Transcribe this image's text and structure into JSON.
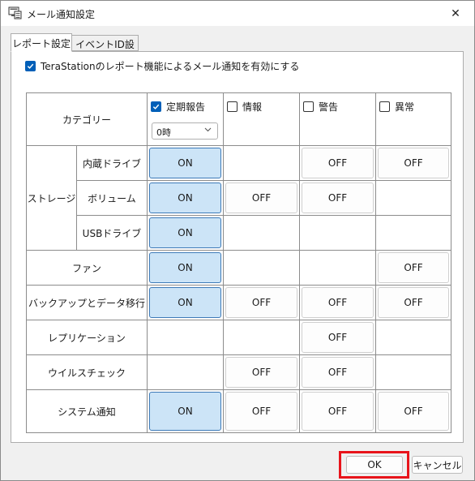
{
  "window": {
    "title": "メール通知設定",
    "icon": "app-window-icon",
    "close_glyph": "✕"
  },
  "tabs": [
    {
      "label": "レポート設定",
      "active": true
    },
    {
      "label": "イベントID設定",
      "active": false
    }
  ],
  "enable_checkbox": {
    "label": "TeraStationのレポート機能によるメール通知を有効にする",
    "checked": true
  },
  "table": {
    "category_header": "カテゴリー",
    "columns": [
      {
        "label": "定期報告",
        "checked": true
      },
      {
        "label": "情報",
        "checked": false
      },
      {
        "label": "警告",
        "checked": false
      },
      {
        "label": "異常",
        "checked": false
      }
    ],
    "schedule_select": {
      "value": "0時"
    },
    "groups": {
      "storage": "ストレージ"
    },
    "rows": [
      {
        "group": "storage",
        "label": "内蔵ドライブ",
        "cells": [
          "ON",
          "",
          "OFF",
          "OFF"
        ]
      },
      {
        "group": "storage",
        "label": "ボリューム",
        "cells": [
          "ON",
          "OFF",
          "OFF",
          ""
        ]
      },
      {
        "group": "storage",
        "label": "USBドライブ",
        "cells": [
          "ON",
          "",
          "",
          ""
        ]
      },
      {
        "label": "ファン",
        "cells": [
          "ON",
          "",
          "",
          "OFF"
        ]
      },
      {
        "label": "バックアップとデータ移行",
        "cells": [
          "ON",
          "OFF",
          "OFF",
          "OFF"
        ]
      },
      {
        "label": "レプリケーション",
        "cells": [
          "",
          "",
          "OFF",
          ""
        ]
      },
      {
        "label": "ウイルスチェック",
        "cells": [
          "",
          "OFF",
          "OFF",
          ""
        ]
      },
      {
        "label": "システム通知",
        "cells": [
          "ON",
          "OFF",
          "OFF",
          "OFF"
        ]
      }
    ]
  },
  "buttons": {
    "ok": "OK",
    "cancel": "キャンセル"
  },
  "colors": {
    "on_fill": "#cce4f7",
    "on_border": "#3d7ab8",
    "checkbox_accent": "#005fb8",
    "highlight_red": "#e8141b"
  }
}
